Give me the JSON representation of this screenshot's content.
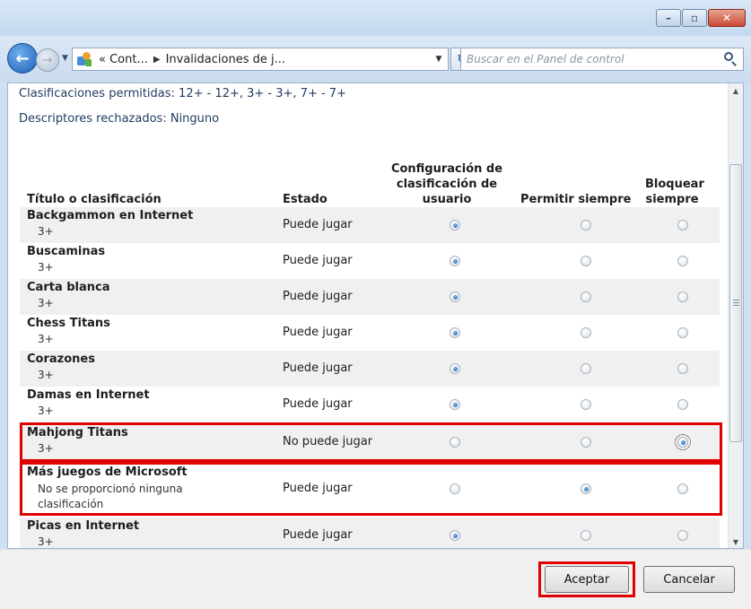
{
  "navigation": {
    "breadcrumbs": [
      "« Cont...",
      "Invalidaciones de j..."
    ],
    "search_placeholder": "Buscar en el Panel de control"
  },
  "info": {
    "allowed": "Clasificaciones permitidas: 12+ - 12+, 3+ - 3+, 7+ - 7+",
    "rejected": "Descriptores rechazados: Ninguno"
  },
  "table": {
    "headers": {
      "title": "Título o clasificación",
      "state": "Estado",
      "user": "Configuración de clasificación de usuario",
      "allow": "Permitir siempre",
      "block": "Bloquear siempre"
    },
    "rows": [
      {
        "name": "Backgammon en Internet",
        "rating": "3+",
        "state": "Puede jugar",
        "selected": "user"
      },
      {
        "name": "Buscaminas",
        "rating": "3+",
        "state": "Puede jugar",
        "selected": "user"
      },
      {
        "name": "Carta blanca",
        "rating": "3+",
        "state": "Puede jugar",
        "selected": "user"
      },
      {
        "name": "Chess Titans",
        "rating": "3+",
        "state": "Puede jugar",
        "selected": "user"
      },
      {
        "name": "Corazones",
        "rating": "3+",
        "state": "Puede jugar",
        "selected": "user"
      },
      {
        "name": "Damas en Internet",
        "rating": "3+",
        "state": "Puede jugar",
        "selected": "user"
      },
      {
        "name": "Mahjong Titans",
        "rating": "3+",
        "state": "No puede jugar",
        "selected": "block"
      },
      {
        "name": "Más juegos de Microsoft",
        "rating": "No se proporcionó ninguna clasificación",
        "state": "Puede jugar",
        "selected": "allow"
      },
      {
        "name": "Picas en Internet",
        "rating": "3+",
        "state": "Puede jugar",
        "selected": "user"
      }
    ]
  },
  "buttons": {
    "ok": "Aceptar",
    "cancel": "Cancelar"
  },
  "colors": {
    "highlight": "#e00000",
    "frame": "#cfe0f3"
  }
}
